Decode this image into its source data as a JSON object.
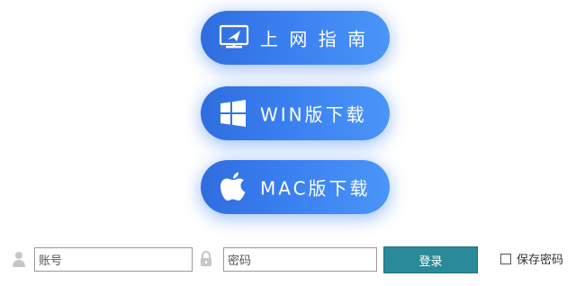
{
  "buttons": {
    "guide": {
      "label": "上 网 指 南",
      "icon": "monitor-send-icon"
    },
    "win": {
      "label": "WIN版下载",
      "icon": "windows-logo-icon"
    },
    "mac": {
      "label": "MAC版下载",
      "icon": "apple-logo-icon"
    }
  },
  "login": {
    "account_placeholder": "账号",
    "password_placeholder": "密码",
    "login_label": "登录",
    "remember_label": "保存密码",
    "user_icon": "user-icon",
    "lock_icon": "lock-icon"
  },
  "colors": {
    "pill_gradient_start": "#2f6dde",
    "pill_gradient_end": "#4a95f8",
    "login_button": "#2a8a99"
  }
}
